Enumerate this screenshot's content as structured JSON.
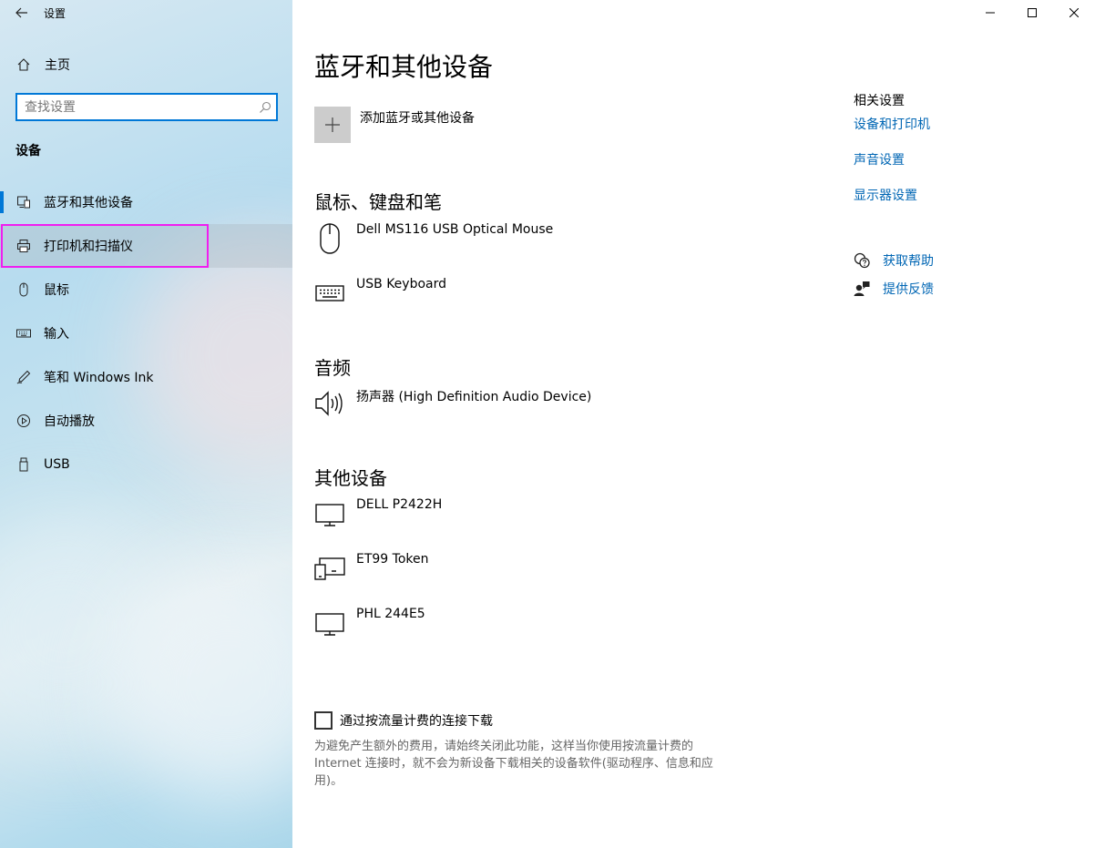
{
  "app": {
    "title": "设置"
  },
  "sidebar": {
    "home_label": "主页",
    "search_placeholder": "查找设置",
    "section": "设备",
    "items": [
      {
        "label": "蓝牙和其他设备",
        "icon": "bluetooth-devices-icon",
        "active": true
      },
      {
        "label": "打印机和扫描仪",
        "icon": "printer-icon",
        "hover": true
      },
      {
        "label": "鼠标",
        "icon": "mouse-icon"
      },
      {
        "label": "输入",
        "icon": "keyboard-icon"
      },
      {
        "label": "笔和 Windows Ink",
        "icon": "pen-icon"
      },
      {
        "label": "自动播放",
        "icon": "autoplay-icon"
      },
      {
        "label": "USB",
        "icon": "usb-icon"
      }
    ]
  },
  "main": {
    "title": "蓝牙和其他设备",
    "add_label": "添加蓝牙或其他设备",
    "groups": {
      "input": {
        "title": "鼠标、键盘和笔",
        "devices": [
          {
            "name": "Dell MS116 USB Optical Mouse",
            "icon": "mouse-icon"
          },
          {
            "name": "USB Keyboard",
            "icon": "keyboard-icon"
          }
        ]
      },
      "audio": {
        "title": "音频",
        "devices": [
          {
            "name": "扬声器 (High Definition Audio Device)",
            "icon": "speaker-icon"
          }
        ]
      },
      "other": {
        "title": "其他设备",
        "devices": [
          {
            "name": "DELL P2422H",
            "icon": "monitor-icon"
          },
          {
            "name": "ET99 Token",
            "icon": "generic-device-icon"
          },
          {
            "name": "PHL 244E5",
            "icon": "monitor-icon"
          }
        ]
      }
    },
    "metered": {
      "label": "通过按流量计费的连接下载",
      "checked": false,
      "description": "为避免产生额外的费用，请始终关闭此功能，这样当你使用按流量计费的 Internet 连接时，就不会为新设备下载相关的设备软件(驱动程序、信息和应用)。"
    }
  },
  "related": {
    "title": "相关设置",
    "links": [
      "设备和打印机",
      "声音设置",
      "显示器设置"
    ],
    "help": [
      {
        "label": "获取帮助",
        "icon": "help-chat-icon"
      },
      {
        "label": "提供反馈",
        "icon": "feedback-icon"
      }
    ]
  },
  "colors": {
    "accent": "#0078d7",
    "link": "#0066b4",
    "highlight": "#f01ef0"
  }
}
